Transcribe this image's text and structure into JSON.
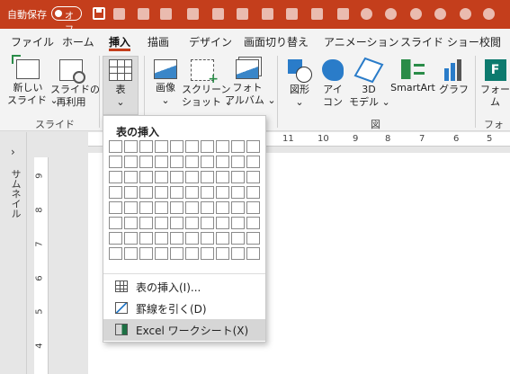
{
  "titlebar": {
    "autosave_label": "自動保存",
    "toggle_label": "オフ"
  },
  "tabs": [
    "ファイル",
    "ホーム",
    "挿入",
    "描画",
    "デザイン",
    "画面切り替え",
    "アニメーション",
    "スライド ショー",
    "校閲"
  ],
  "active_tab": "挿入",
  "ribbon": {
    "slides": {
      "new_slide_1": "新しい",
      "new_slide_2": "スライド ⌄",
      "reuse_1": "スライドの",
      "reuse_2": "再利用",
      "group": "スライド"
    },
    "table": {
      "label": "表",
      "caret": "⌄"
    },
    "images": {
      "image_1": "画像",
      "image_2": "⌄",
      "screenshot_1": "スクリーン",
      "screenshot_2": "ショット ⌄",
      "album_1": "フォト",
      "album_2": "アルバム ⌄"
    },
    "illustrations": {
      "shape_1": "図形",
      "shape_2": "⌄",
      "icon_1": "アイ",
      "icon_2": "コン",
      "model3d_1": "3D",
      "model3d_2": "モデル ⌄",
      "smartart": "SmartArt",
      "graph": "グラフ",
      "group": "図"
    },
    "forms": {
      "form_1": "フォー",
      "form_2": "ム",
      "group": "フォーム"
    }
  },
  "thumbpanel": {
    "label": "サムネイル",
    "chevron": "›"
  },
  "hruler": [
    "11",
    "10",
    "9",
    "8",
    "7",
    "6",
    "5"
  ],
  "vruler": [
    "9",
    "8",
    "7",
    "6",
    "5",
    "4"
  ],
  "dropdown": {
    "title": "表の挿入",
    "grid_cols": 10,
    "grid_rows": 8,
    "items": [
      "表の挿入(I)...",
      "罫線を引く(D)",
      "Excel ワークシート(X)"
    ],
    "highlighted": 2
  },
  "colors": {
    "title_bg": "#c43e1c",
    "ribbon_bg": "#f3f3f3",
    "accent": "#c43e1c"
  }
}
